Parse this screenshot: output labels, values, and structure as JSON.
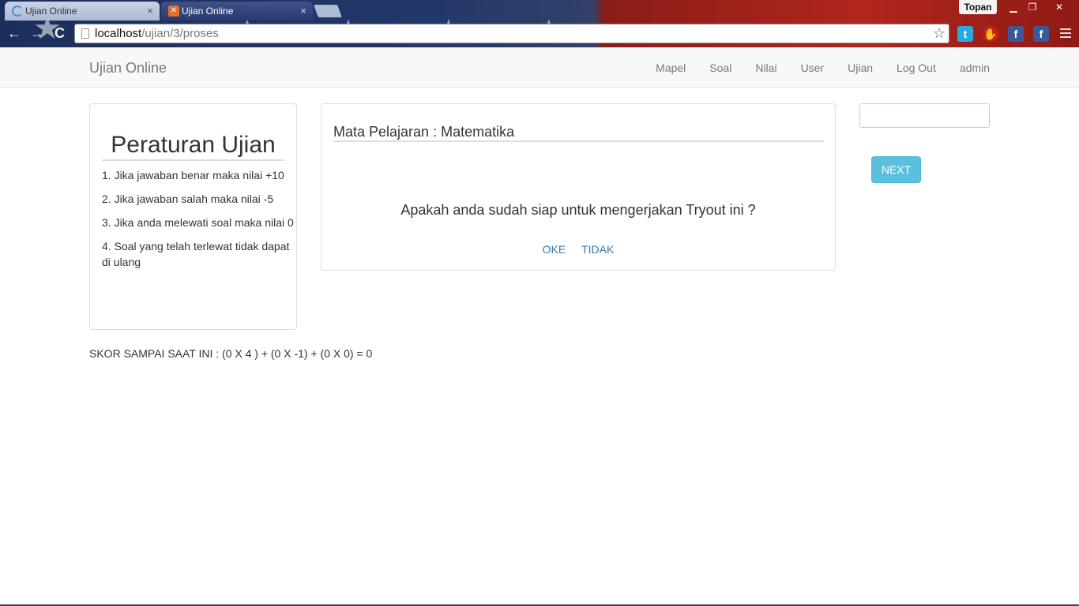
{
  "browser": {
    "tabs": [
      {
        "title": "Ujian Online",
        "active": false
      },
      {
        "title": "Ujian Online",
        "active": true
      }
    ],
    "tab_close": "×",
    "user_name": "Topan",
    "window_buttons": {
      "minimize": "▁",
      "restore": "❐",
      "close": "✕"
    },
    "nav": {
      "back": "←",
      "forward": "→",
      "reload": "C"
    },
    "url_host": "localhost",
    "url_path": "/ujian/3/proses",
    "bookmark_star": "☆",
    "extensions": [
      "twitter-icon",
      "adblock-icon",
      "facebook-icon",
      "facebook-icon"
    ]
  },
  "navbar": {
    "brand": "Ujian Online",
    "links": [
      "Mapel",
      "Soal",
      "Nilai",
      "User",
      "Ujian",
      "Log Out",
      "admin"
    ]
  },
  "rules": {
    "title": "Peraturan Ujian",
    "items": [
      "1. Jika jawaban benar maka nilai +10",
      "2. Jika jawaban salah maka nilai -5",
      "3. Jika anda melewati soal maka nilai 0",
      "4. Soal yang telah terlewat tidak dapat di ulang"
    ]
  },
  "exam": {
    "subject": "Mata Pelajaran : Matematika",
    "question": "Apakah anda sudah siap untuk mengerjakan Tryout ini ?",
    "ok_label": "OKE",
    "cancel_label": "TIDAK"
  },
  "timer_value": "",
  "next_label": "NEXT",
  "score_text": "SKOR SAMPAI SAAT INI : (0 X 4 ) + (0 X -1) + (0 X 0) = 0",
  "colors": {
    "accent": "#5bc0de",
    "link": "#337ab7",
    "navbar_bg": "#f8f8f8"
  }
}
